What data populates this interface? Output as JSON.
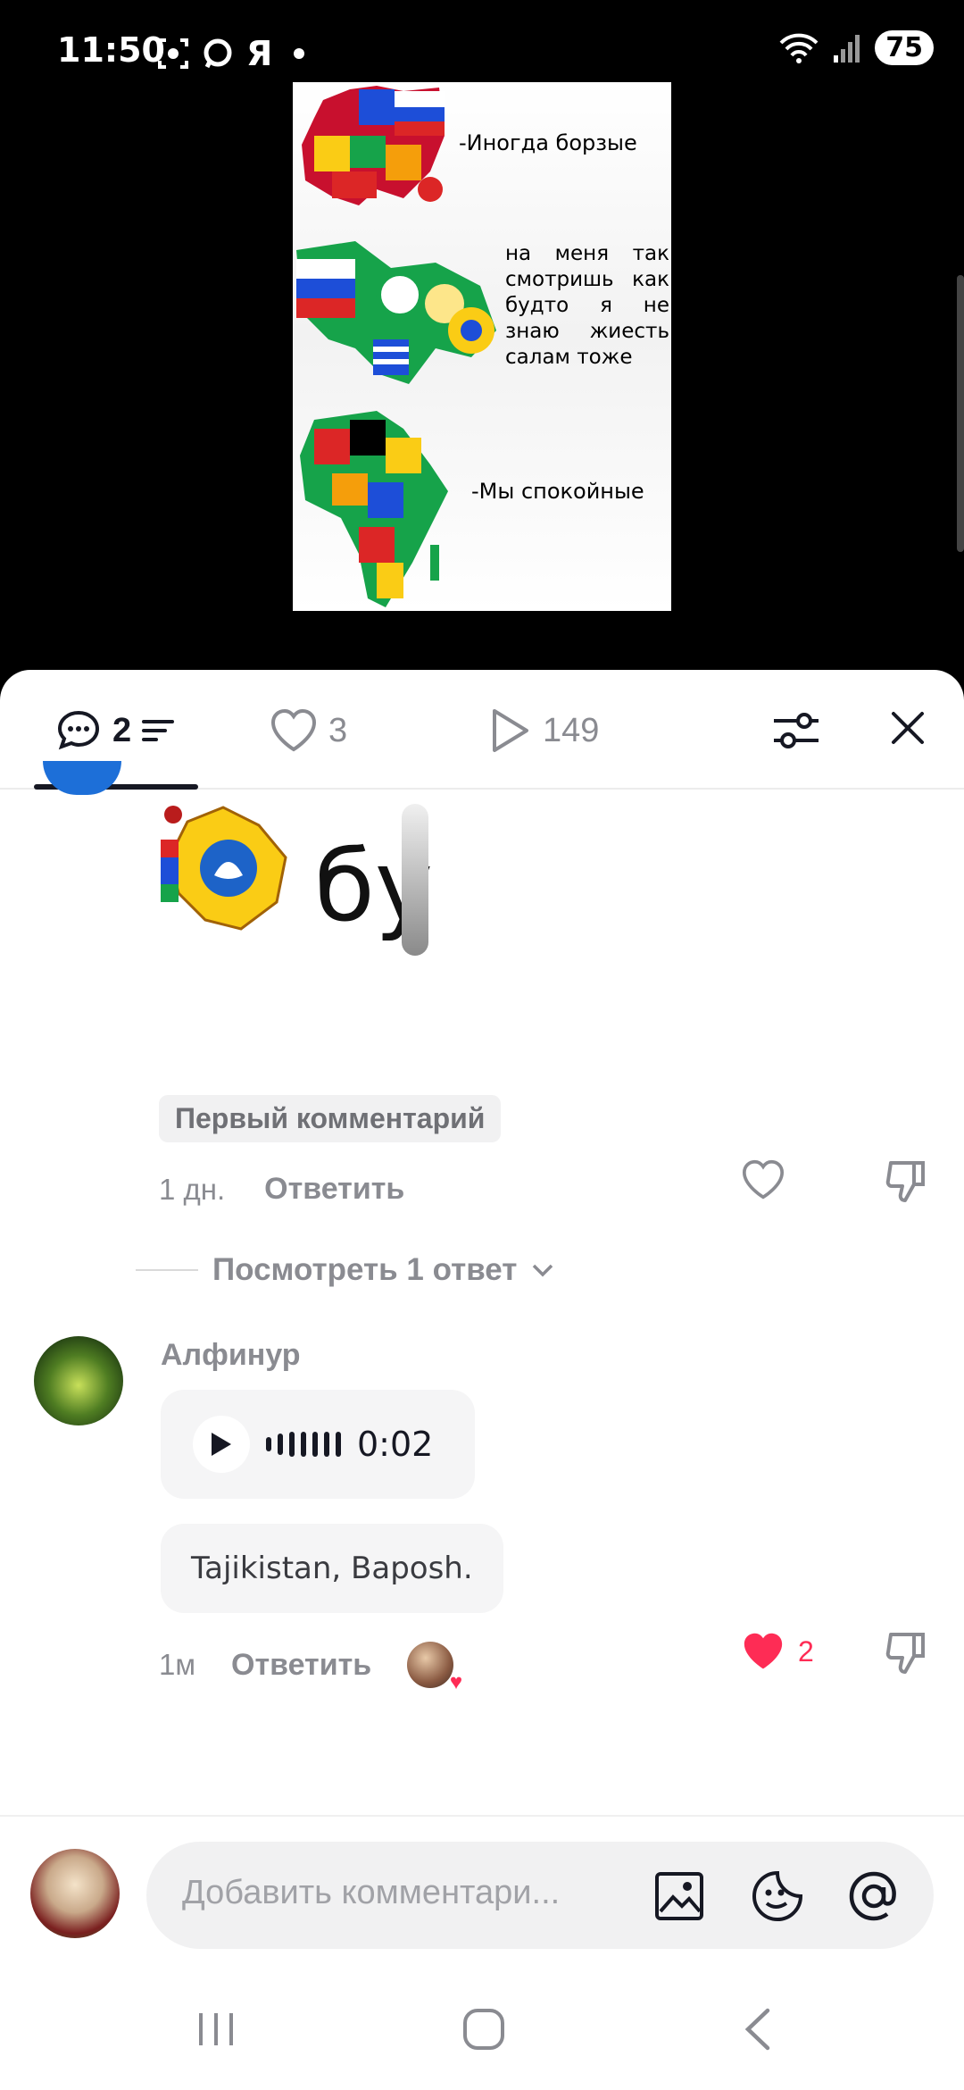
{
  "status_bar": {
    "time": "11:50",
    "app_letter": "Я",
    "battery": "75"
  },
  "video": {
    "meme_captions": {
      "europe": "-Иногда борзые",
      "caucasus": "на меня так смотришь как будто я не знаю жиесть салам тоже",
      "africa": "-Мы спокойные"
    }
  },
  "tabs": {
    "comments_count": "2",
    "likes_count": "3",
    "views_count": "149"
  },
  "comment_1": {
    "sticker_text": "бу",
    "badge": "Первый комментарий",
    "time_ago": "1 дн.",
    "reply_label": "Ответить",
    "view_replies_label": "Посмотреть 1 ответ"
  },
  "comment_2": {
    "username": "Алфинур",
    "voice_duration": "0:02",
    "text": "Tajikistan, Baposh.",
    "time_ago": "1м",
    "reply_label": "Ответить",
    "like_count": "2"
  },
  "input": {
    "placeholder": "Добавить комментари..."
  },
  "colors": {
    "accent_like": "#fe2c55",
    "text_primary": "#161823",
    "text_secondary": "#8a8b91"
  }
}
